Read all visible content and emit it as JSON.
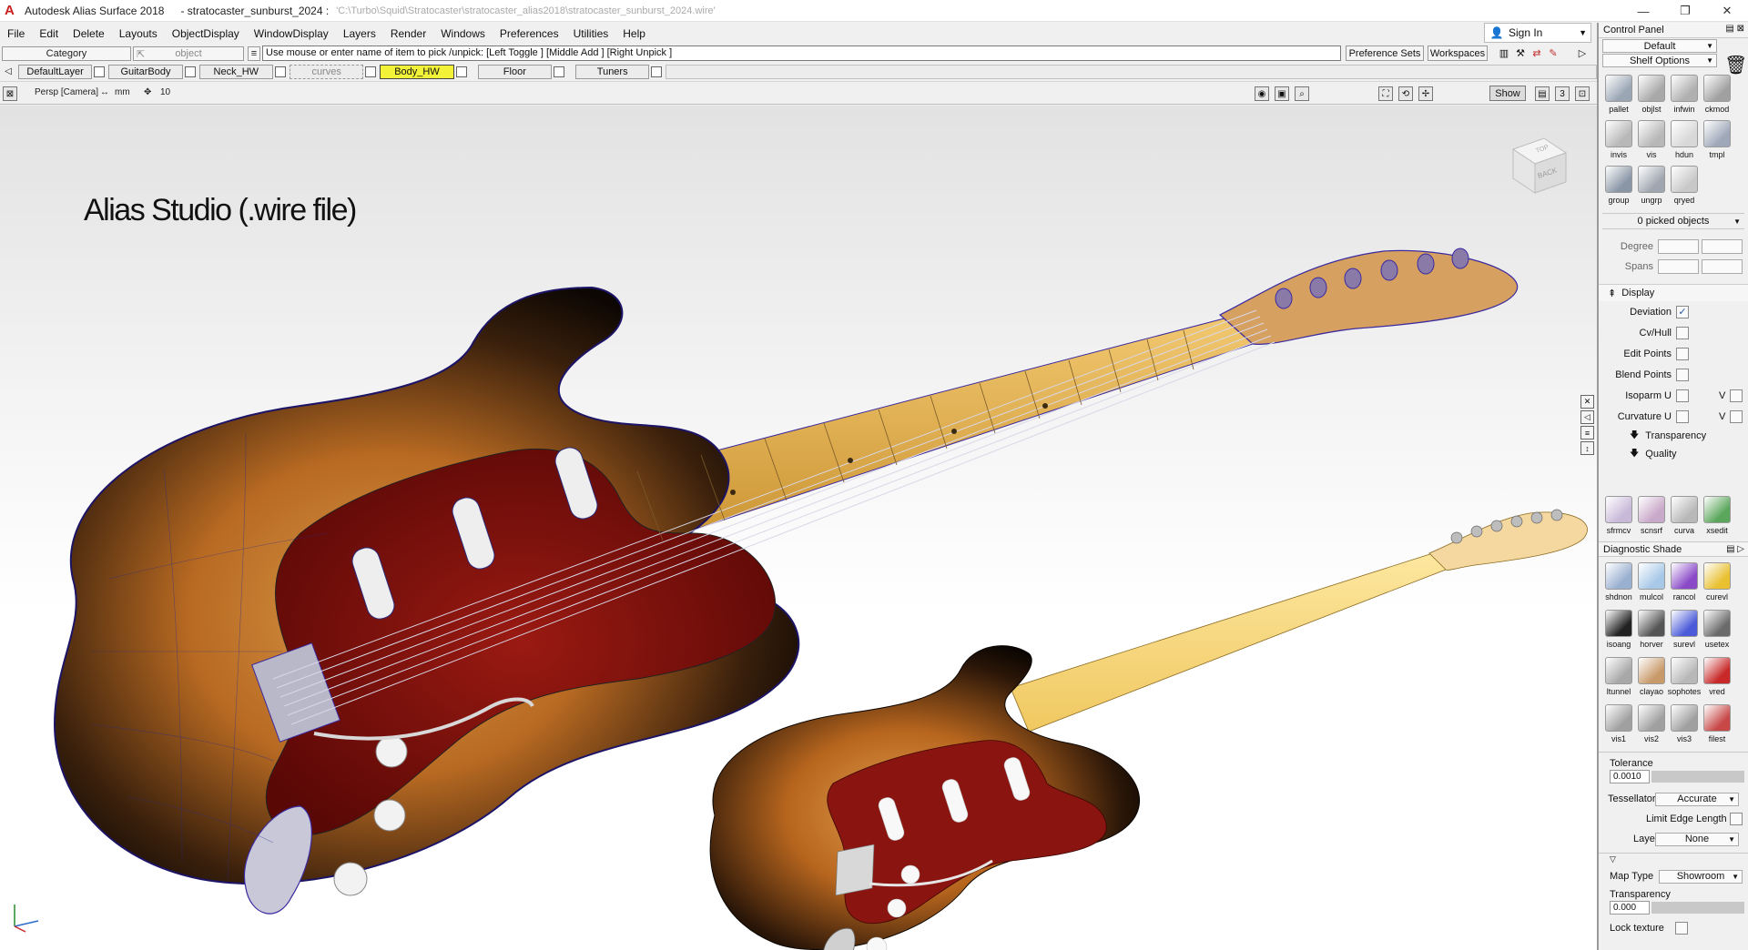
{
  "window": {
    "app_title": "Autodesk Alias Surface 2018",
    "file_title": "- stratocaster_sunburst_2024 :",
    "file_path": "'C:\\Turbo\\Squid\\Stratocaster\\stratocaster_alias2018\\stratocaster_sunburst_2024.wire'",
    "minimize": "—",
    "restore": "❐",
    "close": "✕"
  },
  "menu": [
    "File",
    "Edit",
    "Delete",
    "Layouts",
    "ObjectDisplay",
    "WindowDisplay",
    "Layers",
    "Render",
    "Windows",
    "Preferences",
    "Utilities",
    "Help"
  ],
  "signin": {
    "label": "Sign In"
  },
  "pick_bar": {
    "category": "Category",
    "object": "object",
    "prompt": "Use mouse or enter name of item to pick /unpick: [Left Toggle ] [Middle Add ] [Right Unpick ]",
    "preference_sets": "Preference Sets",
    "workspaces": "Workspaces"
  },
  "layers": [
    {
      "name": "DefaultLayer",
      "state": "normal"
    },
    {
      "name": "GuitarBody",
      "state": "normal"
    },
    {
      "name": "Neck_HW",
      "state": "normal"
    },
    {
      "name": "curves",
      "state": "dashed"
    },
    {
      "name": "Body_HW",
      "state": "active"
    },
    {
      "name": "Floor",
      "state": "normal"
    },
    {
      "name": "Tuners",
      "state": "normal"
    }
  ],
  "viewport": {
    "camera": "Persp [Camera]",
    "units": "mm",
    "grid": "10",
    "show_label": "Show",
    "viewcube_face": "BACK",
    "top_face": "TOP",
    "caption": "Alias Studio (.wire file)"
  },
  "panel": {
    "title": "Control Panel",
    "preset": "Default",
    "shelf_options": "Shelf Options",
    "tools_top": [
      {
        "label": "pallet",
        "icon": "pallet-icon",
        "color": "#9aa6b4"
      },
      {
        "label": "objlst",
        "icon": "object-list-icon",
        "color": "#a8a8a8"
      },
      {
        "label": "infwin",
        "icon": "info-window-icon",
        "color": "#b0b0b0"
      },
      {
        "label": "ckmod",
        "icon": "check-model-icon",
        "color": "#a0a0a0"
      },
      {
        "label": "invis",
        "icon": "invisible-icon",
        "color": "#b8b8b8"
      },
      {
        "label": "vis",
        "icon": "visible-icon",
        "color": "#b8b8b8"
      },
      {
        "label": "hdun",
        "icon": "hide-unselected-icon",
        "color": "#d8d8d8"
      },
      {
        "label": "tmpl",
        "icon": "template-icon",
        "color": "#9fa8b8"
      },
      {
        "label": "group",
        "icon": "group-icon",
        "color": "#8a96a6"
      },
      {
        "label": "ungrp",
        "icon": "ungroup-icon",
        "color": "#a0a6b0"
      },
      {
        "label": "qryed",
        "icon": "query-edit-icon",
        "color": "#c8c8c8"
      }
    ],
    "picked": "0 picked objects",
    "degree_label": "Degree",
    "spans_label": "Spans",
    "display_label": "Display",
    "display_opts": [
      {
        "label": "Deviation",
        "checked": "✓",
        "uv": ""
      },
      {
        "label": "Cv/Hull",
        "checked": "",
        "uv": ""
      },
      {
        "label": "Edit Points",
        "checked": "",
        "uv": ""
      },
      {
        "label": "Blend Points",
        "checked": "",
        "uv": ""
      },
      {
        "label": "Isoparm U",
        "checked": "",
        "uv": "V"
      },
      {
        "label": "Curvature U",
        "checked": "",
        "uv": "V"
      }
    ],
    "transparency_label": "Transparency",
    "quality_label": "Quality",
    "tools_mid": [
      {
        "label": "sfrmcv",
        "icon": "surface-from-curve-icon",
        "color": "#c9b9d9"
      },
      {
        "label": "scnsrf",
        "icon": "scan-surface-icon",
        "color": "#c9a9c9"
      },
      {
        "label": "curva",
        "icon": "curvature-icon",
        "color": "#b8b8b8"
      },
      {
        "label": "xsedit",
        "icon": "xs-edit-icon",
        "color": "#5aa65a"
      }
    ],
    "diag_title": "Diagnostic Shade",
    "diag_tools": [
      {
        "label": "shdnon",
        "icon": "shade-none-icon",
        "color": "#9ab0d0"
      },
      {
        "label": "mulcol",
        "icon": "multi-color-icon",
        "color": "#a8c8e8"
      },
      {
        "label": "rancol",
        "icon": "random-color-icon",
        "color": "#8a4ac8"
      },
      {
        "label": "curevl",
        "icon": "curvature-eval-icon",
        "color": "#e8c030"
      },
      {
        "label": "isoang",
        "icon": "isoangle-icon",
        "color": "#222222"
      },
      {
        "label": "horver",
        "icon": "horizontal-vertical-icon",
        "color": "#555555"
      },
      {
        "label": "surevl",
        "icon": "surface-eval-icon",
        "color": "#4a5ad8"
      },
      {
        "label": "usetex",
        "icon": "use-texture-icon",
        "color": "#6a6a6a"
      },
      {
        "label": "ltunnel",
        "icon": "light-tunnel-icon",
        "color": "#a8a8a8"
      },
      {
        "label": "clayao",
        "icon": "clay-ao-icon",
        "color": "#c89a6a"
      },
      {
        "label": "sophotes",
        "icon": "isophotes-icon",
        "color": "#b8b8b8"
      },
      {
        "label": "vred",
        "icon": "vred-icon",
        "color": "#c82828"
      },
      {
        "label": "vis1",
        "icon": "vis1-icon",
        "color": "#a0a0a0"
      },
      {
        "label": "vis2",
        "icon": "vis2-icon",
        "color": "#a0a0a0"
      },
      {
        "label": "vis3",
        "icon": "vis3-icon",
        "color": "#a0a0a0"
      },
      {
        "label": "filest",
        "icon": "file-settings-icon",
        "color": "#c84848"
      }
    ],
    "tolerance_label": "Tolerance",
    "tolerance_value": "0.0010",
    "tessellator_label": "Tessellator",
    "tessellator_value": "Accurate",
    "limit_edge_label": "Limit Edge Length",
    "layer_label": "Layer",
    "layer_value": "None",
    "map_type_label": "Map Type",
    "map_type_value": "Showroom",
    "transp_label": "Transparency",
    "transp_value": "0.000",
    "lock_texture_label": "Lock texture"
  }
}
